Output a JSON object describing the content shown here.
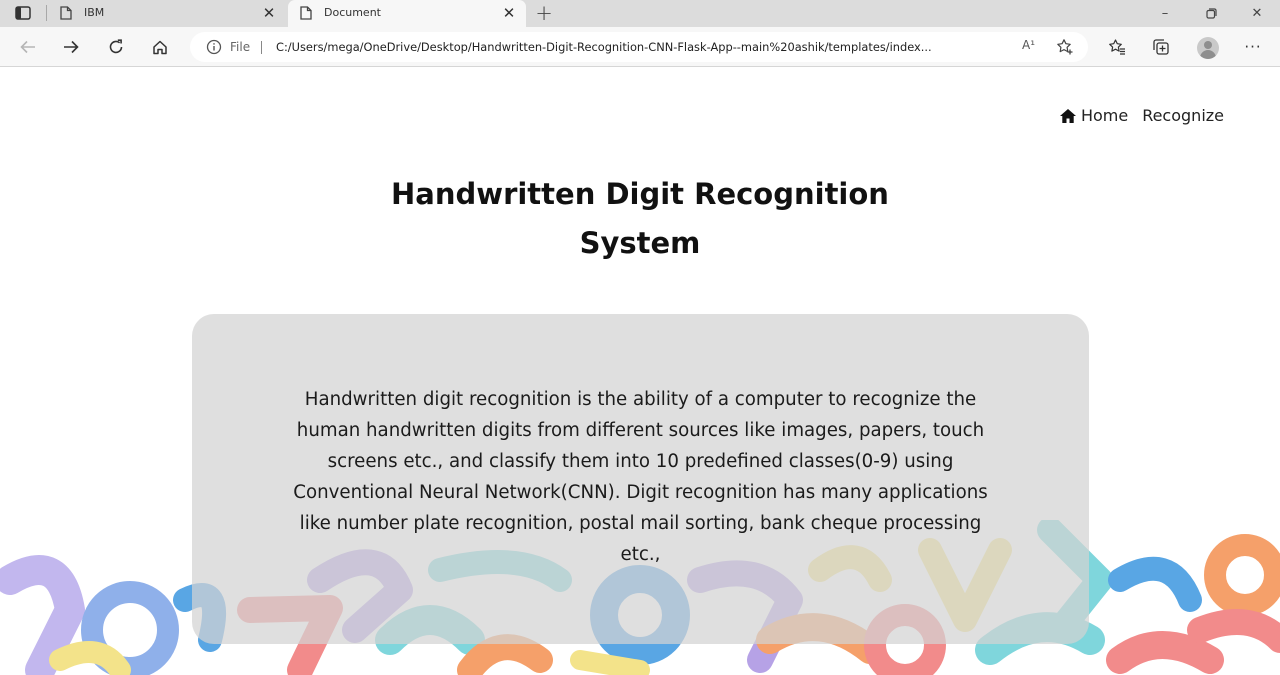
{
  "browser": {
    "tabs": [
      {
        "title": "IBM",
        "active": false
      },
      {
        "title": "Document",
        "active": true
      }
    ],
    "address": {
      "scheme_label": "File",
      "url": "C:/Users/mega/OneDrive/Desktop/Handwritten-Digit-Recognition-CNN-Flask-App--main%20ashik/templates/index...",
      "read_aloud_label": "A¹"
    },
    "window_controls": {
      "minimize": "–",
      "restore": "❐",
      "close": "✕"
    },
    "icons": [
      "tab-actions-icon",
      "document-icon",
      "back-icon",
      "forward-icon",
      "refresh-icon",
      "home-icon",
      "info-icon",
      "add-favorite-icon",
      "favorites-icon",
      "collections-icon",
      "profile-avatar",
      "more-icon"
    ]
  },
  "page": {
    "nav": {
      "home_label": "Home",
      "recognize_label": "Recognize"
    },
    "title_line1": "Handwritten Digit Recognition",
    "title_line2": "System",
    "description": "Handwritten digit recognition is the ability of a computer to recognize the human handwritten digits from different sources like images, papers, touch screens etc., and classify them into 10 predefined classes(0-9) using Conventional Neural Network(CNN). Digit recognition has many applications like number plate recognition, postal mail sorting, bank cheque processing etc.,"
  },
  "colors": {
    "tab_strip": "#dcdcdc",
    "toolbar": "#f7f7f7",
    "card": "#d2d2d2",
    "confetti": [
      "#7fd6dc",
      "#f28b8b",
      "#f5a06a",
      "#8ca8e8",
      "#b6a2e6",
      "#f3e38a",
      "#59a6e4"
    ]
  }
}
